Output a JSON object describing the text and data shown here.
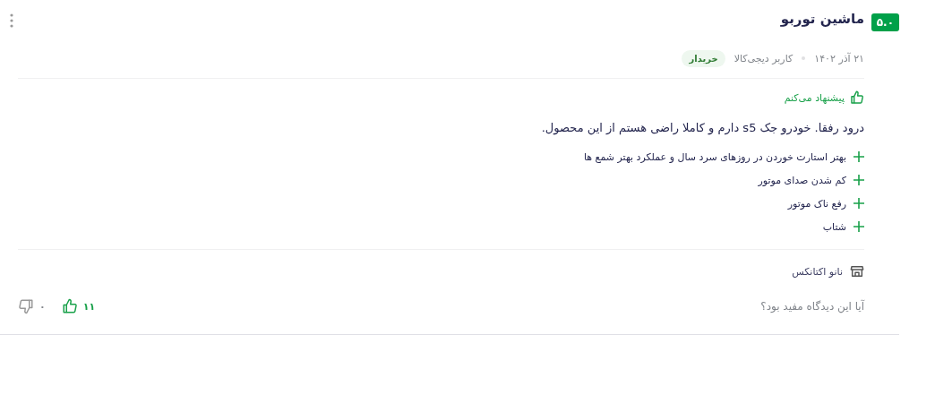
{
  "review": {
    "rating": "۵.۰",
    "title": "ماشین توربو",
    "date": "۲۱ آذر ۱۴۰۲",
    "author": "کاربر دیجی‌کالا",
    "badge": "خریدار",
    "recommendation": "پیشنهاد می‌کنم",
    "body": "درود رفقا. خودرو جک s5 دارم و کاملا راضی هستم از این محصول.",
    "pros": [
      "بهتر استارت خوردن در روزهای سرد سال و عملکرد بهتر شمع ها",
      "کم شدن صدای موتور",
      "رفع ناک موتور",
      "شتاب"
    ],
    "seller": "نانو اکتانکس",
    "helpful_question": "آیا این دیدگاه مفید بود؟",
    "likes": "۱۱",
    "dislikes": "۰"
  }
}
